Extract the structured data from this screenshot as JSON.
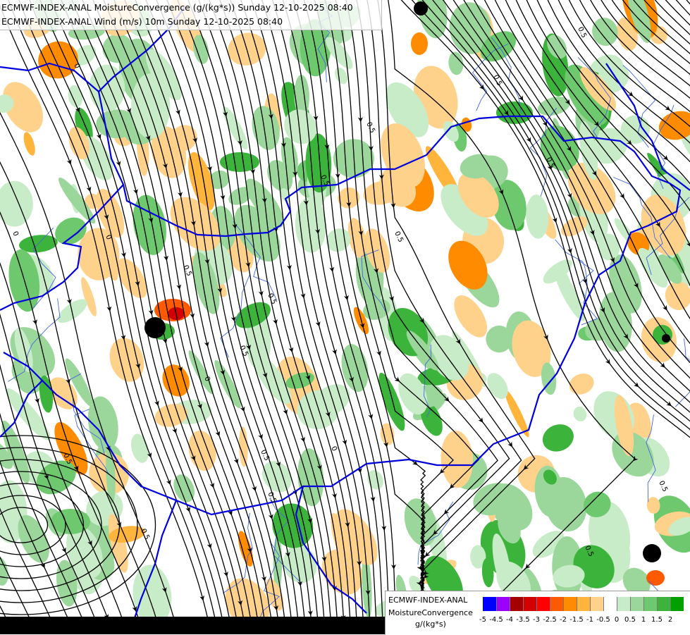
{
  "header": {
    "line1": "ECMWF-INDEX-ANAL MoistureConvergence (g/(kg*s)) Sunday 12-10-2025 08:40",
    "line2": "ECMWF-INDEX-ANAL Wind (m/s) 10m Sunday 12-10-2025 08:40"
  },
  "legend": {
    "title1": "ECMWF-INDEX-ANAL",
    "title2": "MoistureConvergence",
    "unit": "g/(kg*s)",
    "colors": [
      "#0000ff",
      "#9b00ff",
      "#a50000",
      "#d20000",
      "#ff0000",
      "#ff5a00",
      "#ff8c00",
      "#ffb43c",
      "#ffd28c",
      "#ffffff",
      "#c8ebc8",
      "#9bd79b",
      "#6ec86e",
      "#3cb43c",
      "#00a000"
    ],
    "ticks": [
      "-5",
      "-4.5",
      "-4",
      "-3.5",
      "-3",
      "-2.5",
      "-2",
      "-1.5",
      "-1",
      "-0.5",
      "0",
      "0.5",
      "1",
      "1.5",
      "2"
    ]
  },
  "contour_labels": [
    "0.5",
    "0.5",
    "0.5",
    "0.5",
    "0.5",
    "0.5",
    "0.5",
    "0.5",
    "0.5",
    "0.5",
    "0.5",
    "0.5",
    "0.5",
    "0.5",
    "0.5",
    "0",
    "0",
    "0",
    "0",
    "0"
  ],
  "map": {
    "background": "#ffffff",
    "border_color": "#0000dd",
    "river_color": "#4466dd",
    "streamline_color": "#000000",
    "low_color": "#000000"
  }
}
